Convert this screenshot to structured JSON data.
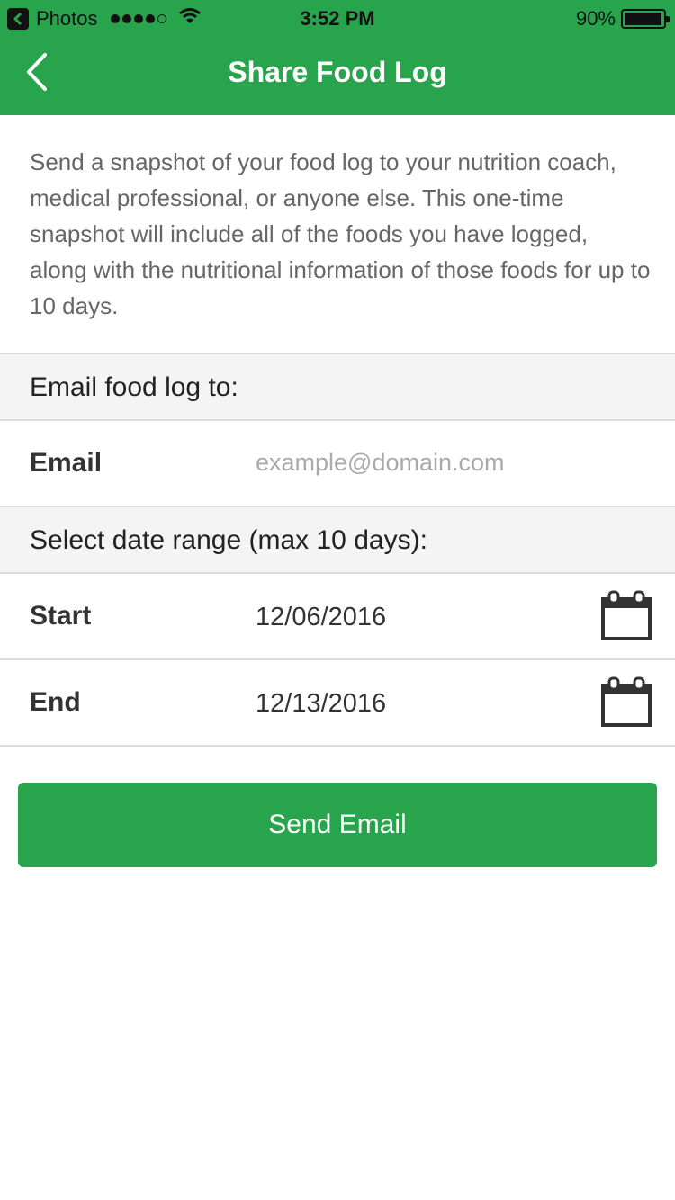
{
  "status_bar": {
    "app_name": "Photos",
    "time": "3:52 PM",
    "battery_text": "90%",
    "battery_level": 0.9
  },
  "nav": {
    "title": "Share Food Log",
    "back_icon": "chevron-left-icon"
  },
  "intro_text": "Send a snapshot of your food log to your nutrition coach, medical professional, or anyone else. This one-time snapshot will include all of the foods you have logged, along with the nutritional information of those foods for up to 10 days.",
  "email_section": {
    "header": "Email food log to:",
    "label": "Email",
    "value": "",
    "placeholder": "example@domain.com"
  },
  "date_section": {
    "header": "Select date range (max 10 days):",
    "start_label": "Start",
    "start_value": "12/06/2016",
    "end_label": "End",
    "end_value": "12/13/2016",
    "calendar_icon": "calendar-icon"
  },
  "send_button": "Send Email",
  "colors": {
    "brand_green": "#28a54c",
    "section_bg": "#f4f4f4",
    "divider": "#dcdcdc"
  }
}
